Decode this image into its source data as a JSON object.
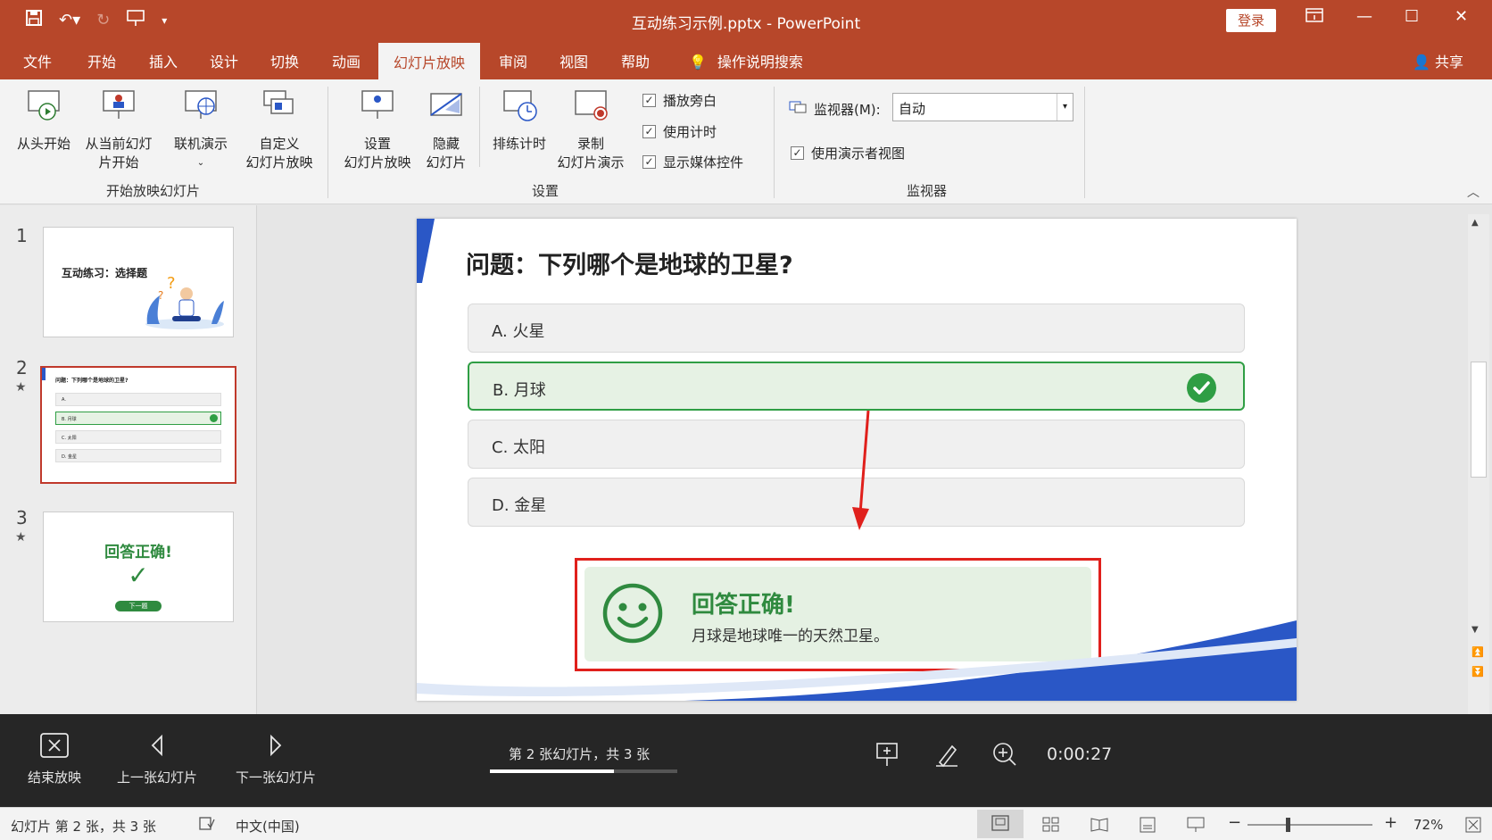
{
  "app": {
    "title": "互动练习示例.pptx  -  PowerPoint",
    "login_label": "登录"
  },
  "tabs": [
    "文件",
    "开始",
    "插入",
    "设计",
    "切换",
    "动画",
    "幻灯片放映",
    "审阅",
    "视图",
    "帮助"
  ],
  "active_tab": "幻灯片放映",
  "tell_me": "操作说明搜索",
  "share_label": "共享",
  "ribbon": {
    "start_group": {
      "label": "开始放映幻灯片",
      "from_beginning": "从头开始",
      "from_current_1": "从当前幻灯",
      "from_current_2": "片开始",
      "online": "联机演示",
      "custom_1": "自定义",
      "custom_2": "幻灯片放映"
    },
    "setup_group": {
      "label": "设置",
      "setup_1": "设置",
      "setup_2": "幻灯片放映",
      "hide_1": "隐藏",
      "hide_2": "幻灯片",
      "rehearse": "排练计时",
      "record_1": "录制",
      "record_2": "幻灯片演示",
      "chk_narration": "播放旁白",
      "chk_timing": "使用计时",
      "chk_media": "显示媒体控件"
    },
    "monitor_group": {
      "label": "监视器",
      "monitor_label": "监视器(M):",
      "monitor_value": "自动",
      "presenter_view": "使用演示者视图"
    }
  },
  "thumbnails": [
    {
      "num": "1",
      "title": "互动练习：选择题",
      "starred": false
    },
    {
      "num": "2",
      "title": "问题：下列哪个是地球的卫星?",
      "starred": true,
      "options": [
        "A.",
        "B. 月球",
        "C. 太阳",
        "D. 金星"
      ]
    },
    {
      "num": "3",
      "title": "回答正确!",
      "button": "下一题",
      "starred": true
    }
  ],
  "slide": {
    "question": "问题：下列哪个是地球的卫星?",
    "options": [
      {
        "label": "A.  火星",
        "correct": false
      },
      {
        "label": "B.  月球",
        "correct": true
      },
      {
        "label": "C.  太阳",
        "correct": false
      },
      {
        "label": "D.  金星",
        "correct": false
      }
    ],
    "feedback_title": "回答正确!",
    "feedback_text": "月球是地球唯一的天然卫星。"
  },
  "presenter": {
    "end_show": "结束放映",
    "prev": "上一张幻灯片",
    "next": "下一张幻灯片",
    "counter": "第 2 张幻灯片，共 3 张",
    "progress": 0.66,
    "timer": "0:00:27"
  },
  "status": {
    "slide_info": "幻灯片 第 2 张，共 3 张",
    "language": "中文(中国)",
    "zoom": "72%"
  },
  "colors": {
    "brand": "#b7472a",
    "correct_green": "#2f9e44",
    "highlight_red": "#e0201c",
    "slide_accent_blue": "#2a57c6"
  }
}
